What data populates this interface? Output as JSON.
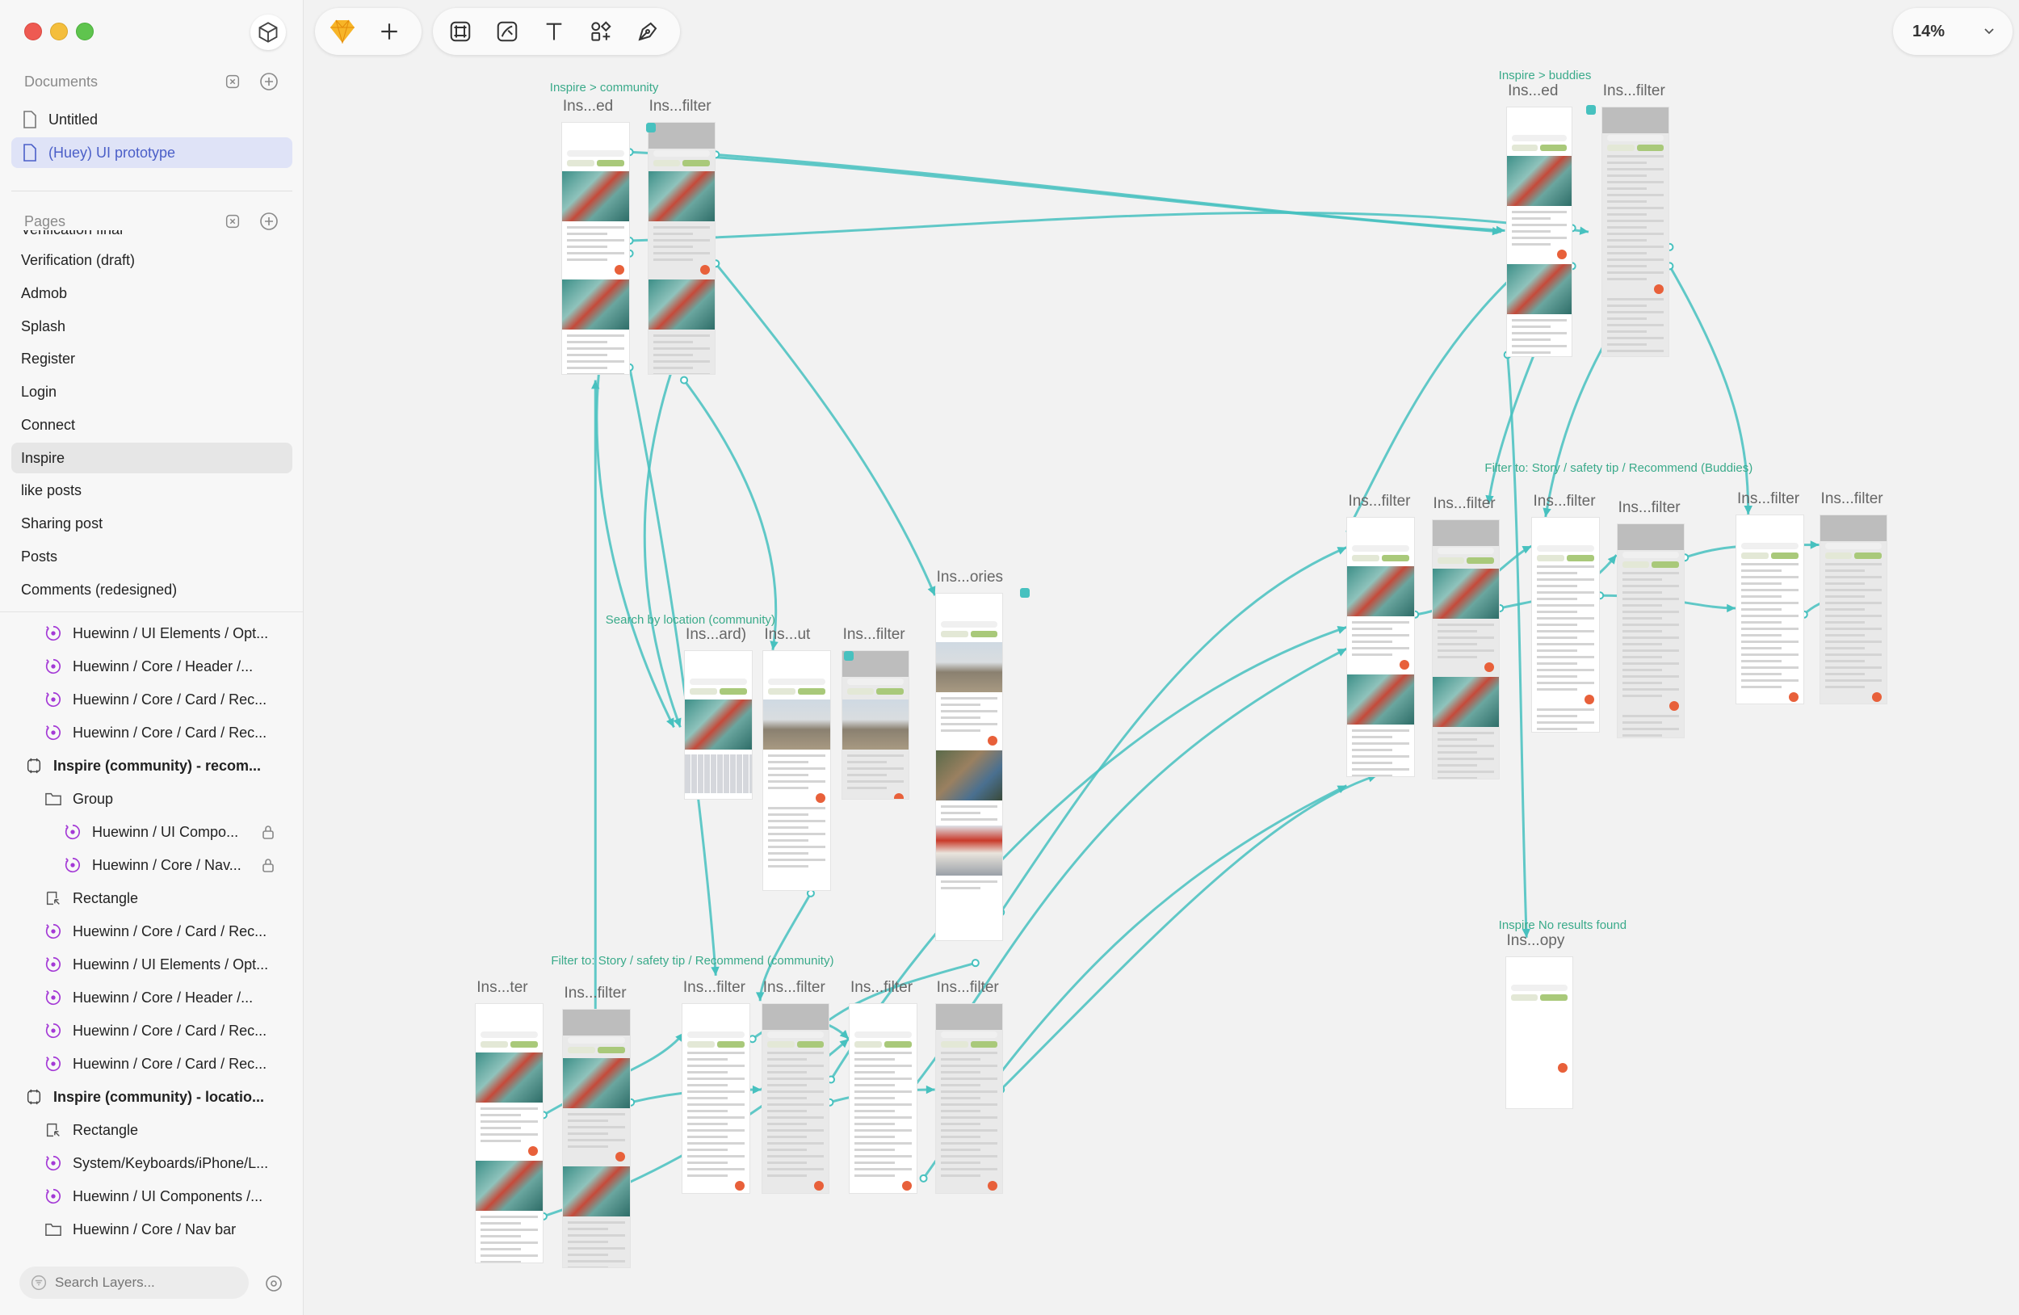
{
  "sidebar": {
    "documents_title": "Documents",
    "documents": [
      {
        "label": "Untitled",
        "selected": false
      },
      {
        "label": "(Huey) UI prototype",
        "selected": true
      }
    ],
    "pages_title": "Pages",
    "pages": [
      {
        "label": "Verification final"
      },
      {
        "label": "Verification (draft)"
      },
      {
        "label": "Admob"
      },
      {
        "label": "Splash"
      },
      {
        "label": "Register"
      },
      {
        "label": "Login"
      },
      {
        "label": "Connect"
      },
      {
        "label": "Inspire",
        "selected": true
      },
      {
        "label": "like posts"
      },
      {
        "label": "Sharing post"
      },
      {
        "label": "Posts"
      },
      {
        "label": "Comments (redesigned)"
      }
    ],
    "layers": [
      {
        "label": "Huewinn / UI Elements / Opt...",
        "icon": "symbol-icon",
        "indent": 1
      },
      {
        "label": "Huewinn / Core / Header /...",
        "icon": "symbol-icon",
        "indent": 1
      },
      {
        "label": "Huewinn / Core / Card / Rec...",
        "icon": "symbol-icon",
        "indent": 1
      },
      {
        "label": "Huewinn / Core / Card / Rec...",
        "icon": "symbol-icon",
        "indent": 1
      },
      {
        "label": "Inspire (community) - recom...",
        "icon": "artboard-icon",
        "indent": 0,
        "bold": true
      },
      {
        "label": "Group",
        "icon": "folder-icon",
        "indent": 1
      },
      {
        "label": "Huewinn / UI Compo...",
        "icon": "symbol-icon",
        "indent": 2,
        "locked": true
      },
      {
        "label": "Huewinn / Core / Nav...",
        "icon": "symbol-icon",
        "indent": 2,
        "locked": true
      },
      {
        "label": "Rectangle",
        "icon": "rectangle-icon",
        "indent": 1
      },
      {
        "label": "Huewinn / Core / Card / Rec...",
        "icon": "symbol-icon",
        "indent": 1
      },
      {
        "label": "Huewinn / UI Elements / Opt...",
        "icon": "symbol-icon",
        "indent": 1
      },
      {
        "label": "Huewinn / Core / Header /...",
        "icon": "symbol-icon",
        "indent": 1
      },
      {
        "label": "Huewinn / Core / Card / Rec...",
        "icon": "symbol-icon",
        "indent": 1
      },
      {
        "label": "Huewinn / Core / Card / Rec...",
        "icon": "symbol-icon",
        "indent": 1
      },
      {
        "label": "Inspire (community) - locatio...",
        "icon": "artboard-icon",
        "indent": 0,
        "bold": true
      },
      {
        "label": "Rectangle",
        "icon": "rectangle-icon",
        "indent": 1
      },
      {
        "label": "System/Keyboards/iPhone/L...",
        "icon": "symbol-icon",
        "indent": 1
      },
      {
        "label": "Huewinn / UI Components /...",
        "icon": "symbol-icon",
        "indent": 1
      },
      {
        "label": "Huewinn / Core / Nav bar",
        "icon": "folder-icon",
        "indent": 1
      }
    ],
    "search_placeholder": "Search Layers..."
  },
  "toolbar": {
    "zoom": "14%"
  },
  "canvas": {
    "flow_labels": [
      {
        "id": "fl1",
        "text": "Inspire > community"
      },
      {
        "id": "fl2",
        "text": "Inspire > buddies"
      },
      {
        "id": "fl3",
        "text": "Search by location (community)"
      },
      {
        "id": "fl4",
        "text": "Filter to: Story / safety tip / Recommend (Buddies)"
      },
      {
        "id": "fl5",
        "text": "Filter to: Story / safety tip / Recommend (community)"
      },
      {
        "id": "fl6",
        "text": "Inspire No results found"
      }
    ],
    "artboards": [
      {
        "id": "a1",
        "label": "Ins...ed"
      },
      {
        "id": "a2",
        "label": "Ins...filter"
      },
      {
        "id": "a3",
        "label": "Ins...ed"
      },
      {
        "id": "a4",
        "label": "Ins...filter"
      },
      {
        "id": "a5",
        "label": "Ins...ories"
      },
      {
        "id": "a6",
        "label": "Ins...ard)"
      },
      {
        "id": "a7",
        "label": "Ins...ut"
      },
      {
        "id": "a8",
        "label": "Ins...filter"
      },
      {
        "id": "a9",
        "label": "Ins...filter"
      },
      {
        "id": "a10",
        "label": "Ins...filter"
      },
      {
        "id": "a11",
        "label": "Ins...filter"
      },
      {
        "id": "a12",
        "label": "Ins...filter"
      },
      {
        "id": "a13",
        "label": "Ins...filter"
      },
      {
        "id": "a14",
        "label": "Ins...filter"
      },
      {
        "id": "a15",
        "label": "Ins...opy"
      },
      {
        "id": "a16",
        "label": "Ins...ter"
      },
      {
        "id": "a17",
        "label": "Ins...filter"
      },
      {
        "id": "a18",
        "label": "Ins...filter"
      },
      {
        "id": "a19",
        "label": "Ins...filter"
      },
      {
        "id": "a20",
        "label": "Ins...filter"
      },
      {
        "id": "a21",
        "label": "Ins...filter"
      }
    ]
  },
  "colors": {
    "prototype_link": "#47c1bf",
    "selected_document": "#4b5fc8",
    "symbol_icon": "#a43ad6",
    "accent_tab": "#a9c97a",
    "fab": "#e8603a"
  }
}
